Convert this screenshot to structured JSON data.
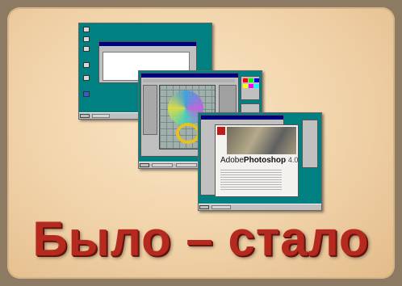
{
  "heading": "Было – стало",
  "splash": {
    "brand": "Adobe",
    "product_prefix": "Adobe",
    "product_name": "Photoshop",
    "version": "4.0"
  },
  "colors": {
    "desktop": "#008080",
    "title_text": "#b42a1e",
    "panel": "#f0d2a8",
    "border": "#8d7a62"
  },
  "icons": [
    "my-computer-icon",
    "recycle-bin-icon",
    "start-icon"
  ]
}
